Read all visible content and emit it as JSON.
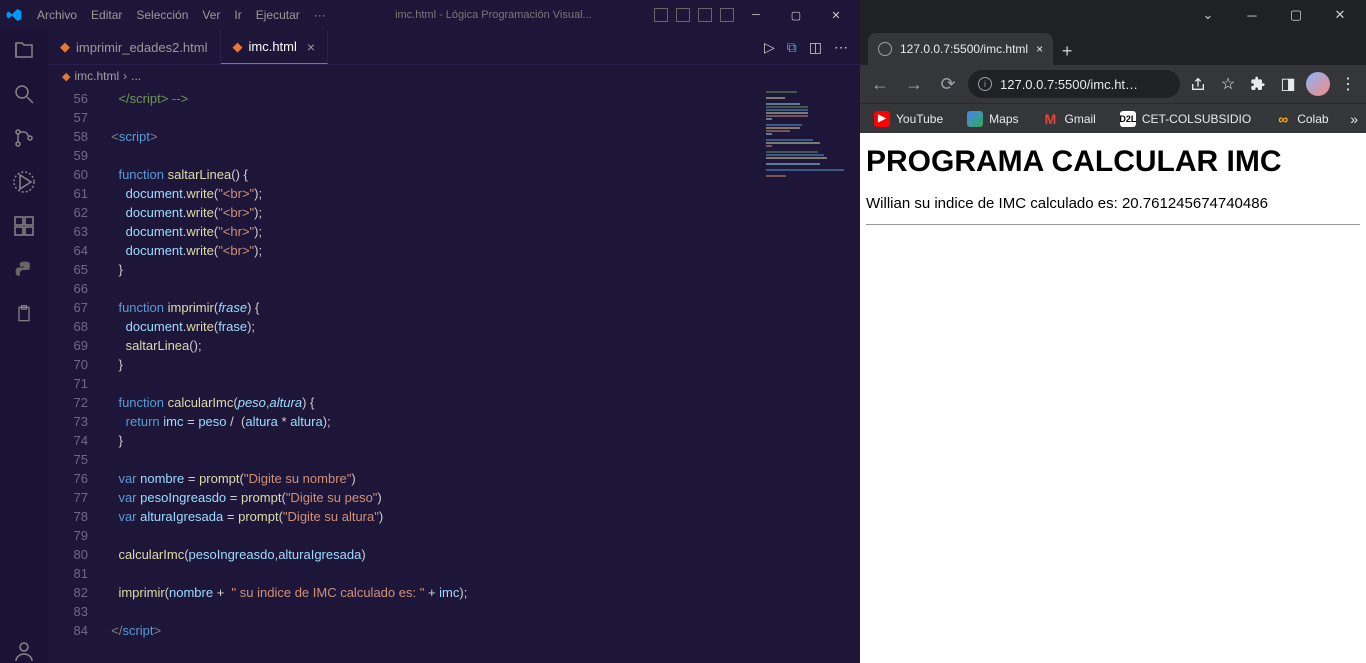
{
  "vscode": {
    "menu": [
      "Archivo",
      "Editar",
      "Selección",
      "Ver",
      "Ir",
      "Ejecutar",
      "···"
    ],
    "window_title": "imc.html - Lógica Programación Visual...",
    "tabs": [
      {
        "label": "imprimir_edades2.html",
        "active": false
      },
      {
        "label": "imc.html",
        "active": true
      }
    ],
    "breadcrumb": {
      "file": "imc.html",
      "sep": "›",
      "more": "..."
    },
    "line_start": 56,
    "code_lines": [
      {
        "n": 56,
        "html": "  <span class='cm'>  &lt;/script&gt; --&gt;</span>"
      },
      {
        "n": 57,
        "html": ""
      },
      {
        "n": 58,
        "html": "  <span class='tag'>&lt;</span><span class='tagname'>script</span><span class='tag'>&gt;</span>"
      },
      {
        "n": 59,
        "html": ""
      },
      {
        "n": 60,
        "html": "    <span class='kw'>function</span> <span class='fn'>saltarLinea</span>() {"
      },
      {
        "n": 61,
        "html": "      <span class='var'>document</span>.<span class='fn'>write</span>(<span class='str'>\"&lt;br&gt;\"</span>);"
      },
      {
        "n": 62,
        "html": "      <span class='var'>document</span>.<span class='fn'>write</span>(<span class='str'>\"&lt;br&gt;\"</span>);"
      },
      {
        "n": 63,
        "html": "      <span class='var'>document</span>.<span class='fn'>write</span>(<span class='str'>\"&lt;hr&gt;\"</span>);"
      },
      {
        "n": 64,
        "html": "      <span class='var'>document</span>.<span class='fn'>write</span>(<span class='str'>\"&lt;br&gt;\"</span>);"
      },
      {
        "n": 65,
        "html": "    }"
      },
      {
        "n": 66,
        "html": ""
      },
      {
        "n": 67,
        "html": "    <span class='kw'>function</span> <span class='fn'>imprimir</span>(<span class='param'>frase</span>) {"
      },
      {
        "n": 68,
        "html": "      <span class='var'>document</span>.<span class='fn'>write</span>(<span class='var'>frase</span>);"
      },
      {
        "n": 69,
        "html": "      <span class='fn'>saltarLinea</span>();"
      },
      {
        "n": 70,
        "html": "    }"
      },
      {
        "n": 71,
        "html": ""
      },
      {
        "n": 72,
        "html": "    <span class='kw'>function</span> <span class='fn'>calcularImc</span>(<span class='param'>peso</span>,<span class='param'>altura</span>) {"
      },
      {
        "n": 73,
        "html": "      <span class='kw'>return</span> <span class='var'>imc</span> <span class='op'>=</span> <span class='var'>peso</span> <span class='op'>/</span>  (<span class='var'>altura</span> <span class='op'>*</span> <span class='var'>altura</span>);"
      },
      {
        "n": 74,
        "html": "    }"
      },
      {
        "n": 75,
        "html": ""
      },
      {
        "n": 76,
        "html": "    <span class='kw'>var</span> <span class='var'>nombre</span> <span class='op'>=</span> <span class='fn'>prompt</span>(<span class='str'>\"Digite su nombre\"</span>)"
      },
      {
        "n": 77,
        "html": "    <span class='kw'>var</span> <span class='var'>pesoIngreasdo</span> <span class='op'>=</span> <span class='fn'>prompt</span>(<span class='str'>\"Digite su peso\"</span>)"
      },
      {
        "n": 78,
        "html": "    <span class='kw'>var</span> <span class='var'>alturaIgresada</span> <span class='op'>=</span> <span class='fn'>prompt</span>(<span class='str'>\"Digite su altura\"</span>)"
      },
      {
        "n": 79,
        "html": ""
      },
      {
        "n": 80,
        "html": "    <span class='fn'>calcularImc</span>(<span class='var'>pesoIngreasdo</span>,<span class='var'>alturaIgresada</span>)"
      },
      {
        "n": 81,
        "html": ""
      },
      {
        "n": 82,
        "html": "    <span class='fn'>imprimir</span>(<span class='var'>nombre</span> <span class='op'>+</span>  <span class='str'>\" su indice de IMC calculado es: \"</span> <span class='op'>+</span> <span class='var'>imc</span>);"
      },
      {
        "n": 83,
        "html": ""
      },
      {
        "n": 84,
        "html": "  <span class='tag'>&lt;/</span><span class='tagname'>script</span><span class='tag'>&gt;</span>"
      }
    ]
  },
  "chrome": {
    "tab_title": "127.0.0.7:5500/imc.html",
    "url": "127.0.0.7:5500/imc.ht…",
    "bookmarks": [
      {
        "label": "YouTube",
        "iconClass": "yt",
        "iconText": "▶"
      },
      {
        "label": "Maps",
        "iconClass": "maps",
        "iconText": ""
      },
      {
        "label": "Gmail",
        "iconClass": "gmail",
        "iconText": "M"
      },
      {
        "label": "CET-COLSUBSIDIO",
        "iconClass": "d2l",
        "iconText": "D2L"
      },
      {
        "label": "Colab",
        "iconClass": "colab-i",
        "iconText": "∞"
      }
    ],
    "page": {
      "heading": "PROGRAMA CALCULAR IMC",
      "result": "Willian su indice de IMC calculado es: 20.761245674740486"
    }
  }
}
